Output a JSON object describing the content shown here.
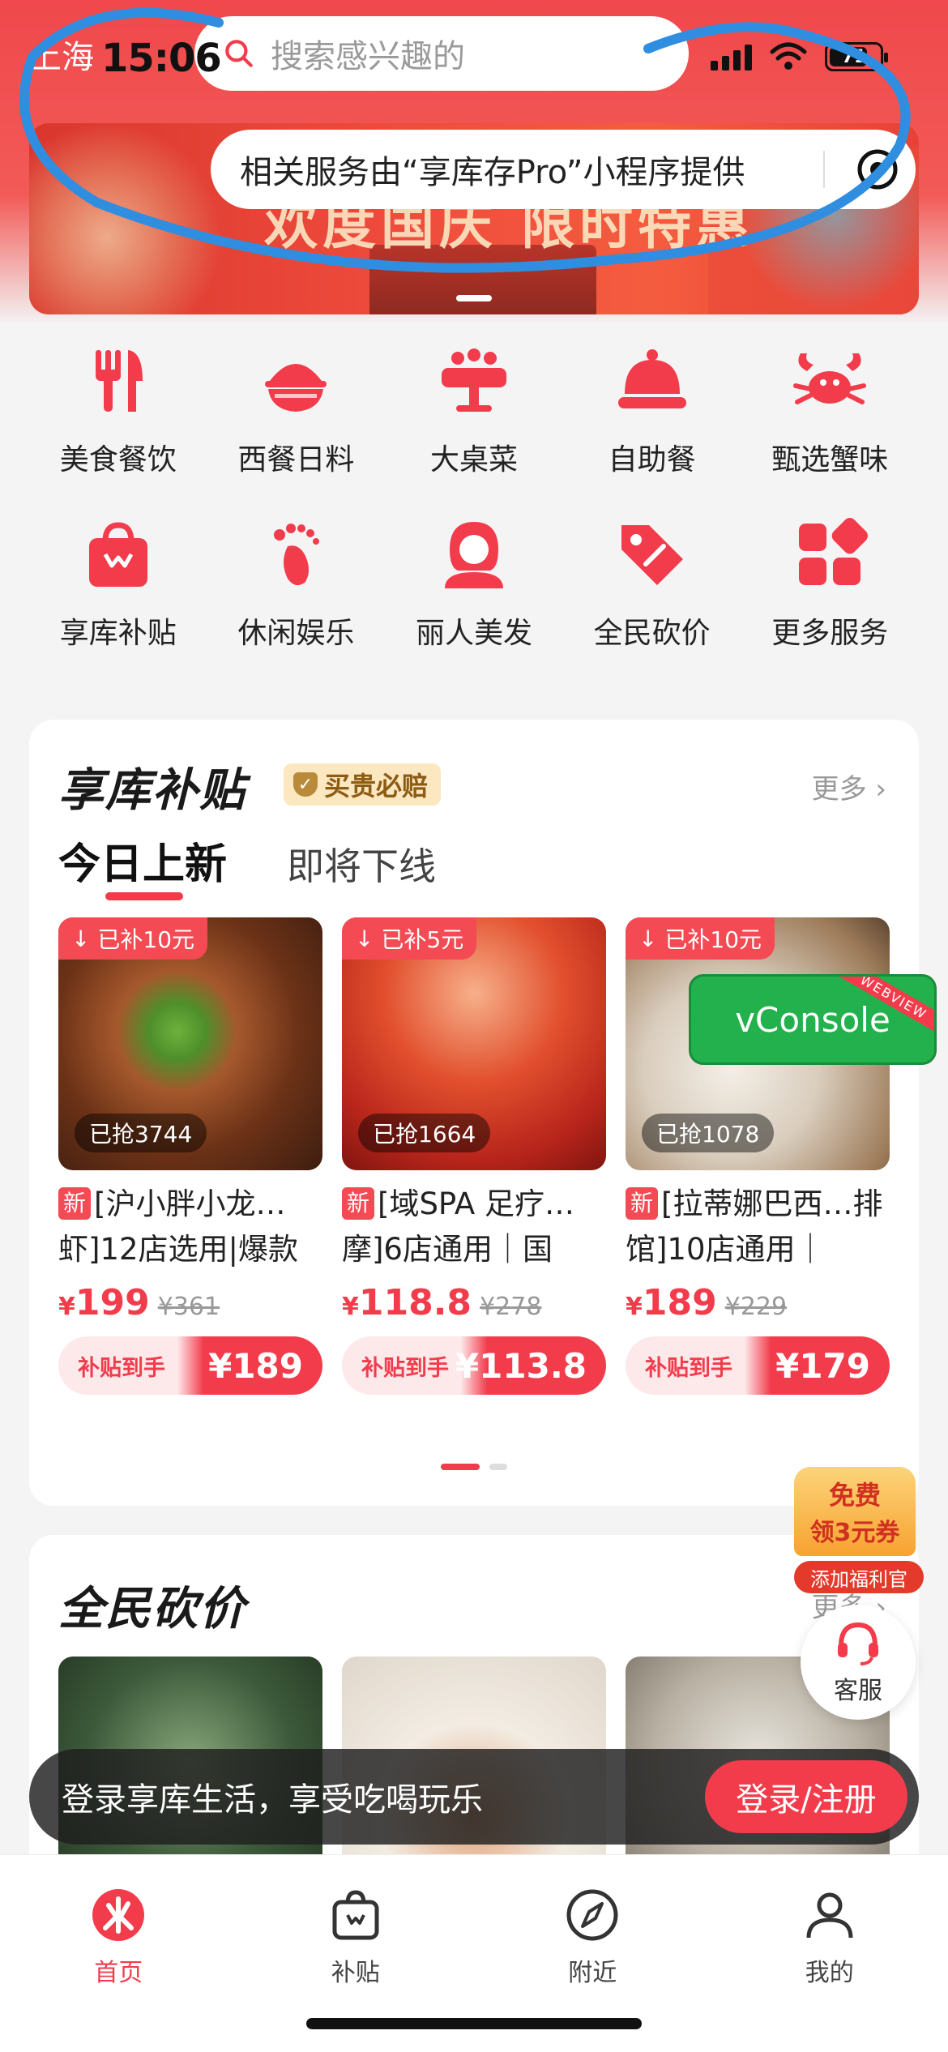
{
  "status_bar": {
    "time": "15:06",
    "battery": "71"
  },
  "header": {
    "city": "上海",
    "search_placeholder": "搜索感兴趣的"
  },
  "banner": {
    "slogan": "欢度国庆 限时特惠",
    "notice": "相关服务由“享库存Pro”小程序提供"
  },
  "categories": [
    {
      "label": "美食餐饮",
      "icon": "fork-knife-icon"
    },
    {
      "label": "西餐日料",
      "icon": "rice-bowl-icon"
    },
    {
      "label": "大桌菜",
      "icon": "banquet-table-icon"
    },
    {
      "label": "自助餐",
      "icon": "food-cloche-icon"
    },
    {
      "label": "甄选蟹味",
      "icon": "crab-icon"
    },
    {
      "label": "享库补贴",
      "icon": "shopping-bag-icon"
    },
    {
      "label": "休闲娱乐",
      "icon": "footprint-icon"
    },
    {
      "label": "丽人美发",
      "icon": "woman-hair-icon"
    },
    {
      "label": "全民砍价",
      "icon": "price-tag-icon"
    },
    {
      "label": "更多服务",
      "icon": "grid-more-icon"
    }
  ],
  "subsidy": {
    "title": "享库补贴",
    "badge": "买贵必赔",
    "more": "更多",
    "tab_active": "今日上新",
    "tab_idle": "即将下线",
    "products": [
      {
        "subsidy": "已补10元",
        "grabbed": "已抢3744",
        "new_tag": "新",
        "name": "[沪小胖小龙…虾]12店选用|爆款",
        "price": "199",
        "orig": "¥361",
        "btn_label": "补贴到手",
        "final": "¥189"
      },
      {
        "subsidy": "已补5元",
        "grabbed": "已抢1664",
        "new_tag": "新",
        "name": "[域SPA 足疗…摩]6店通用｜国",
        "price": "118.8",
        "orig": "¥278",
        "btn_label": "补贴到手",
        "final": "¥113.8"
      },
      {
        "subsidy": "已补10元",
        "grabbed": "已抢1078",
        "new_tag": "新",
        "name": "[拉蒂娜巴西…排馆]10店通用｜",
        "price": "189",
        "orig": "¥229",
        "btn_label": "补贴到手",
        "final": "¥179"
      }
    ],
    "price_symbol": "¥"
  },
  "vconsole": {
    "label": "vConsole",
    "ribbon": "WEBVIEW"
  },
  "bargain": {
    "title": "全民砍价",
    "more": "更多"
  },
  "coupon": {
    "line1": "免费",
    "line2": "领3元券",
    "button": "添加福利官"
  },
  "customer_service": {
    "label": "客服"
  },
  "login_bar": {
    "text": "登录享库生活，享受吃喝玩乐",
    "button": "登录/注册"
  },
  "tabbar": [
    {
      "label": "首页",
      "icon": "home-logo-icon",
      "active": true
    },
    {
      "label": "补贴",
      "icon": "bag-icon",
      "active": false
    },
    {
      "label": "附近",
      "icon": "compass-icon",
      "active": false
    },
    {
      "label": "我的",
      "icon": "person-icon",
      "active": false
    }
  ],
  "colors": {
    "brand_red": "#f23c4c",
    "header_red": "#f0484c",
    "vconsole_green": "#22b14c"
  }
}
